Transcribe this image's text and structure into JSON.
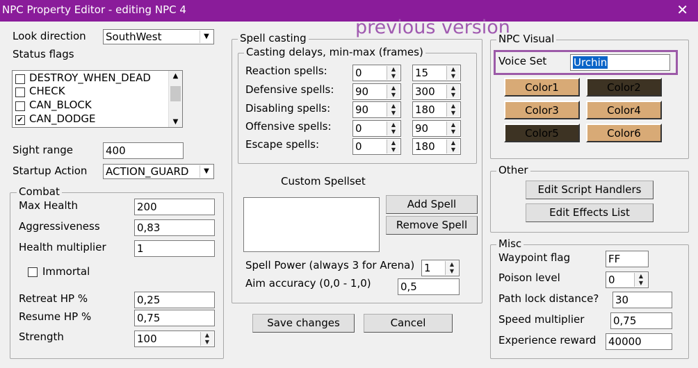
{
  "window": {
    "title": "NPC Property Editor - editing NPC 4",
    "close_glyph": "✕"
  },
  "overlay": {
    "text": "previous version",
    "color": "#a05ab0"
  },
  "left": {
    "look_direction": {
      "label": "Look direction",
      "value": "SouthWest"
    },
    "status_flags": {
      "label": "Status flags",
      "items": [
        {
          "label": "DESTROY_WHEN_DEAD",
          "checked": false
        },
        {
          "label": "CHECK",
          "checked": false
        },
        {
          "label": "CAN_BLOCK",
          "checked": false
        },
        {
          "label": "CAN_DODGE",
          "checked": true
        }
      ]
    },
    "sight_range": {
      "label": "Sight range",
      "value": "400"
    },
    "startup_action": {
      "label": "Startup Action",
      "value": "ACTION_GUARD"
    }
  },
  "combat": {
    "title": "Combat",
    "max_health": {
      "label": "Max Health",
      "value": "200"
    },
    "aggressiveness": {
      "label": "Aggressiveness",
      "value": "0,83"
    },
    "health_multiplier": {
      "label": "Health multiplier",
      "value": "1"
    },
    "immortal": {
      "label": "Immortal",
      "checked": false
    },
    "retreat_hp": {
      "label": "Retreat HP %",
      "value": "0,25"
    },
    "resume_hp": {
      "label": "Resume HP %",
      "value": "0,75"
    },
    "strength": {
      "label": "Strength",
      "value": "100"
    }
  },
  "spell_casting": {
    "title": "Spell casting",
    "delays_title": "Casting delays, min-max (frames)",
    "rows": [
      {
        "label": "Reaction spells:",
        "min": "0",
        "max": "15"
      },
      {
        "label": "Defensive spells:",
        "min": "90",
        "max": "300"
      },
      {
        "label": "Disabling spells:",
        "min": "90",
        "max": "180"
      },
      {
        "label": "Offensive spells:",
        "min": "0",
        "max": "90"
      },
      {
        "label": "Escape spells:",
        "min": "0",
        "max": "180"
      }
    ],
    "custom_spellset": "Custom Spellset",
    "add_spell": "Add Spell",
    "remove_spell": "Remove Spell",
    "spell_power": {
      "label": "Spell Power (always 3 for Arena)",
      "value": "1"
    },
    "aim_accuracy": {
      "label": "Aim accuracy (0,0 - 1,0)",
      "value": "0,5"
    }
  },
  "actions": {
    "save": "Save changes",
    "cancel": "Cancel"
  },
  "npc_visual": {
    "title": "NPC Visual",
    "voice_set": {
      "label": "Voice Set",
      "value": "Urchin"
    },
    "colors": [
      {
        "label": "Color1",
        "bg": "#d8aa76",
        "fg": "#000000"
      },
      {
        "label": "Color2",
        "bg": "#3d3323",
        "fg": "#000000"
      },
      {
        "label": "Color3",
        "bg": "#d8aa76",
        "fg": "#000000"
      },
      {
        "label": "Color4",
        "bg": "#d8aa76",
        "fg": "#000000"
      },
      {
        "label": "Color5",
        "bg": "#3d3323",
        "fg": "#000000"
      },
      {
        "label": "Color6",
        "bg": "#d8aa76",
        "fg": "#000000"
      }
    ],
    "highlight_color": "#9c5aa8"
  },
  "other": {
    "title": "Other",
    "edit_script": "Edit Script Handlers",
    "edit_effects": "Edit Effects List"
  },
  "misc": {
    "title": "Misc",
    "waypoint_flag": {
      "label": "Waypoint flag",
      "value": "FF"
    },
    "poison_level": {
      "label": "Poison level",
      "value": "0"
    },
    "path_lock": {
      "label": "Path lock distance?",
      "value": "30"
    },
    "speed_multiplier": {
      "label": "Speed multiplier",
      "value": "0,75"
    },
    "experience_reward": {
      "label": "Experience reward",
      "value": "40000"
    }
  }
}
